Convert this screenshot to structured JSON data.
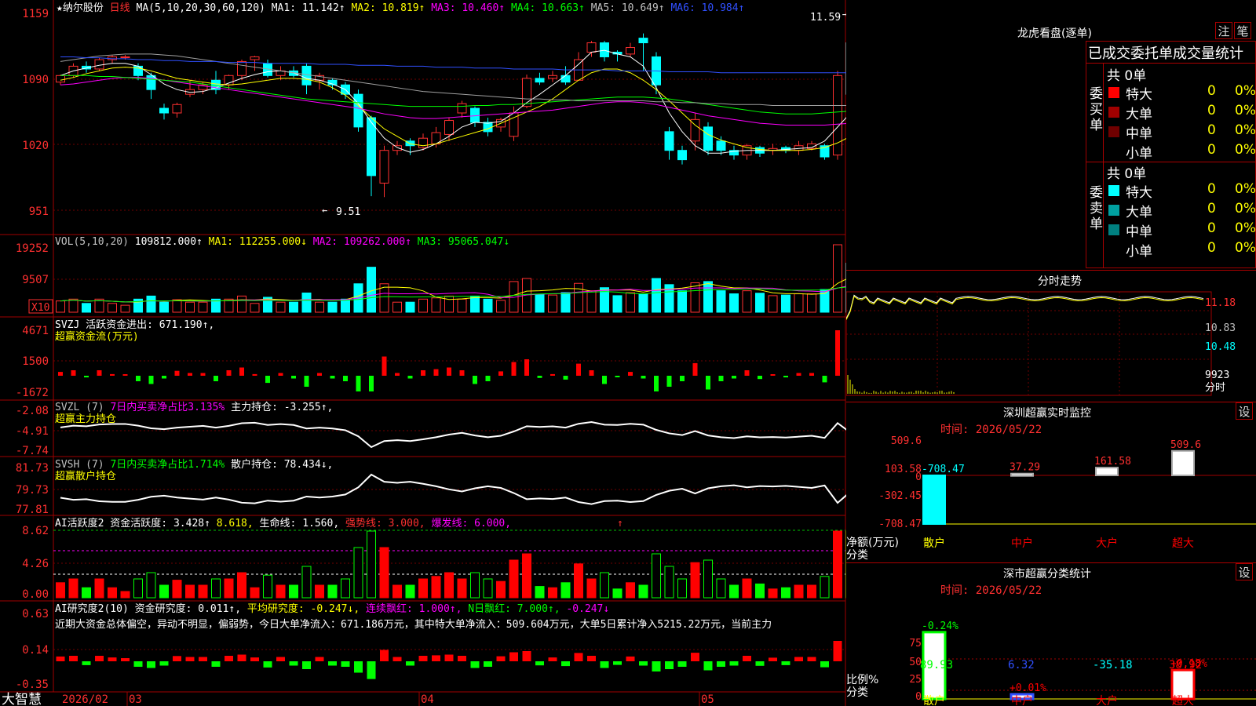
{
  "stock": {
    "name": "纳尔股份",
    "period": "日线",
    "ma_label": "MA(5,10,20,30,60,120)",
    "ma_values": [
      {
        "label": "MA1: 11.142↑",
        "color": "#ffffff"
      },
      {
        "label": "MA2: 10.819↑",
        "color": "#ffff00"
      },
      {
        "label": "MA3: 10.460↑",
        "color": "#ff00ff"
      },
      {
        "label": "MA4: 10.663↑",
        "color": "#00ff00"
      },
      {
        "label": "MA5: 10.649↑",
        "color": "#c0c0c0"
      },
      {
        "label": "MA6: 10.984↑",
        "color": "#3050ff"
      }
    ],
    "price_axis": [
      "1159",
      "1090",
      "1020",
      "951"
    ],
    "high_label": "11.59",
    "low_label": "9.51"
  },
  "vol": {
    "header": "VOL(5,10,20)",
    "value": "109812.000↑",
    "ma1": "MA1: 112255.000↓",
    "ma2": "MA2: 109262.000↑",
    "ma3": "MA3: 95065.047↓",
    "axis": [
      "19252",
      "9507",
      "X10"
    ]
  },
  "svzj": {
    "header": "SVZJ  活跃资金进出: 671.190↑,",
    "sub": "超赢资金流(万元)",
    "axis": [
      "4671",
      "1500",
      "-1672"
    ]
  },
  "svzl": {
    "h1": "SVZL (7)",
    "h2": "7日内买卖净占比3.135%",
    "h3": "主力持仓: -3.255↑,",
    "sub": "超赢主力持仓",
    "axis": [
      "-2.08",
      "-4.91",
      "-7.74"
    ]
  },
  "svsh": {
    "h1": "SVSH (7)",
    "h2": "7日内买卖净占比1.714%",
    "h3": "散户持仓: 78.434↓,",
    "sub": "超赢散户持仓",
    "axis": [
      "81.73",
      "79.73",
      "77.81"
    ]
  },
  "ai_active": {
    "h1": "AI活跃度2 资金活跃度: 3.428↑",
    "h2": "8.618,",
    "h3": "生命线: 1.560,",
    "h4": "强势线: 3.000,",
    "h5": "爆发线: 6.000,",
    "h6": "↑",
    "axis": [
      "8.62",
      "4.26",
      "0.00"
    ]
  },
  "ai_research": {
    "h1": "AI研究度2(10) 资金研究度: 0.011↑,",
    "h2": "平均研究度: -0.247↓,",
    "h3": "连续飘红: 1.000↑,",
    "h4": "N日飘红: 7.000↑,",
    "h5": "-0.247↓",
    "comment": "近期大资金总体偏空，异动不明显，偏弱势，今日大单净流入：671.186万元，其中特大单净流入：509.604万元，大单5日累计净入5215.22万元，当前主力",
    "axis": [
      "0.63",
      "0.14",
      "-0.35"
    ]
  },
  "date_axis": {
    "brand": "大智慧",
    "labels": [
      "2026/02",
      "03",
      "04",
      "05"
    ]
  },
  "right": {
    "lhb_title": "龙虎看盘(逐单)",
    "btn1": "注",
    "btn2": "笔",
    "order_title": "已成交委托单成交量统计",
    "buy_label": "委买单",
    "sell_label": "委卖单",
    "buy_total": "共 0单",
    "sell_total": "共 0单",
    "buy_rows": [
      {
        "name": "特大",
        "count": "0",
        "pct": "0%",
        "color": "#ff0000"
      },
      {
        "name": "大单",
        "count": "0",
        "pct": "0%",
        "color": "#a00000"
      },
      {
        "name": "中单",
        "count": "0",
        "pct": "0%",
        "color": "#700000"
      },
      {
        "name": "小单",
        "count": "0",
        "pct": "0%",
        "color": ""
      }
    ],
    "sell_rows": [
      {
        "name": "特大",
        "count": "0",
        "pct": "0%",
        "color": "#00ffff"
      },
      {
        "name": "大单",
        "count": "0",
        "pct": "0%",
        "color": "#00a0a0"
      },
      {
        "name": "中单",
        "count": "0",
        "pct": "0%",
        "color": "#008080"
      },
      {
        "name": "小单",
        "count": "0",
        "pct": "0%",
        "color": ""
      }
    ],
    "intraday_title": "分时走势",
    "intraday_axis": [
      "11.18",
      "10.83",
      "10.48",
      "9923",
      "分时"
    ],
    "sz_monitor_title": "深圳超赢实时监控",
    "sz_btn": "设",
    "sz_time": "时间: 2026/05/22",
    "sz_axis": [
      "509.6",
      "103.58",
      "0",
      "-302.45",
      "-708.47"
    ],
    "sz_ylabel": "净额(万元)",
    "sz_xlabel": "分类",
    "sz_bars": [
      {
        "cat": "散户",
        "value": -708.47,
        "label": "-708.47",
        "cat_color": "#ffff00"
      },
      {
        "cat": "中户",
        "value": 37.29,
        "label": "37.29",
        "cat_color": "#ff0000"
      },
      {
        "cat": "大户",
        "value": 161.58,
        "label": "161.58",
        "cat_color": "#ff0000"
      },
      {
        "cat": "超大",
        "value": 509.6,
        "label": "509.6",
        "cat_color": "#ff0000"
      }
    ],
    "sc_title": "深市超赢分类统计",
    "sc_btn": "设",
    "sc_time": "时间: 2026/05/22",
    "sc_axis": [
      "75",
      "50",
      "25",
      "0"
    ],
    "sc_ylabel": "比例%",
    "sc_xlabel": "分类",
    "sc_bars": [
      {
        "cat": "散户",
        "value": 89.93,
        "label": "89.93",
        "top": "-0.24%",
        "top_color": "#00ff00",
        "val_color": "#00ff00",
        "cat_color": "#ffff00"
      },
      {
        "cat": "中户",
        "value": 6.32,
        "label": "6.32",
        "top": "+0.01%",
        "top_color": "#ff0000",
        "val_color": "#3050ff",
        "cat_color": "#ff0000"
      },
      {
        "cat": "大户",
        "value": -35.18,
        "label": "-35.18",
        "top": "",
        "top_color": "#ff0000",
        "val_color": "#00ffff",
        "cat_color": "#ff0000"
      },
      {
        "cat": "超大",
        "value": 38.92,
        "label": "38.92",
        "top": "+0.18%",
        "top_color": "#ff0000",
        "val_color": "#ff0000",
        "cat_color": "#ff0000"
      }
    ]
  },
  "chart_data": {
    "type": "candlestick",
    "ylim": [
      9.51,
      11.59
    ],
    "candles": [
      [
        10.88,
        10.95,
        10.85,
        10.96
      ],
      [
        10.95,
        11.05,
        10.93,
        11.08
      ],
      [
        11.05,
        11.02,
        10.98,
        11.1
      ],
      [
        11.02,
        11.12,
        11.0,
        11.14
      ],
      [
        11.12,
        11.15,
        11.08,
        11.17
      ],
      [
        11.15,
        11.15,
        11.12,
        11.17
      ],
      [
        11.05,
        10.95,
        10.9,
        11.08
      ],
      [
        10.95,
        10.8,
        10.7,
        10.98
      ],
      [
        10.6,
        10.55,
        10.48,
        10.65
      ],
      [
        10.55,
        10.64,
        10.5,
        10.66
      ],
      [
        10.75,
        10.8,
        10.72,
        10.9
      ],
      [
        10.8,
        10.85,
        10.75,
        10.88
      ],
      [
        10.9,
        10.8,
        10.75,
        11.0
      ],
      [
        10.85,
        10.95,
        10.8,
        10.96
      ],
      [
        10.95,
        11.1,
        10.9,
        11.12
      ],
      [
        11.12,
        11.15,
        11.0,
        11.16
      ],
      [
        11.08,
        10.95,
        10.93,
        11.12
      ],
      [
        10.95,
        11.0,
        10.9,
        11.05
      ],
      [
        11.0,
        10.95,
        10.93,
        11.05
      ],
      [
        11.05,
        10.85,
        10.75,
        11.08
      ],
      [
        10.9,
        10.95,
        10.8,
        10.98
      ],
      [
        10.9,
        10.85,
        10.8,
        10.92
      ],
      [
        10.85,
        10.75,
        10.7,
        10.88
      ],
      [
        10.75,
        10.4,
        10.35,
        10.8
      ],
      [
        10.5,
        9.88,
        9.66,
        10.52
      ],
      [
        9.8,
        10.15,
        9.65,
        10.2
      ],
      [
        10.15,
        10.2,
        10.1,
        10.25
      ],
      [
        10.25,
        10.2,
        10.1,
        10.28
      ],
      [
        10.18,
        10.28,
        10.15,
        10.33
      ],
      [
        10.22,
        10.34,
        10.18,
        10.4
      ],
      [
        10.32,
        10.47,
        10.25,
        10.5
      ],
      [
        10.55,
        10.65,
        10.5,
        10.68
      ],
      [
        10.6,
        10.45,
        10.4,
        10.62
      ],
      [
        10.45,
        10.35,
        10.3,
        10.5
      ],
      [
        10.4,
        10.48,
        10.35,
        10.5
      ],
      [
        10.3,
        10.55,
        10.25,
        10.62
      ],
      [
        10.62,
        10.92,
        10.6,
        10.96
      ],
      [
        10.92,
        10.88,
        10.85,
        10.98
      ],
      [
        10.92,
        10.95,
        10.88,
        11.0
      ],
      [
        10.95,
        10.88,
        10.85,
        11.05
      ],
      [
        10.9,
        11.12,
        10.9,
        11.2
      ],
      [
        11.2,
        11.3,
        11.15,
        11.32
      ],
      [
        11.3,
        11.15,
        11.1,
        11.32
      ],
      [
        11.2,
        11.18,
        11.1,
        11.22
      ],
      [
        11.18,
        11.25,
        11.15,
        11.3
      ],
      [
        11.35,
        11.3,
        11.0,
        11.4
      ],
      [
        11.15,
        10.85,
        10.75,
        11.2
      ],
      [
        10.35,
        10.15,
        10.05,
        10.4
      ],
      [
        10.15,
        10.05,
        10.0,
        10.2
      ],
      [
        10.25,
        10.48,
        10.15,
        10.55
      ],
      [
        10.4,
        10.15,
        10.1,
        10.45
      ],
      [
        10.25,
        10.15,
        10.1,
        10.3
      ],
      [
        10.15,
        10.1,
        10.05,
        10.2
      ],
      [
        10.1,
        10.2,
        10.05,
        10.22
      ],
      [
        10.18,
        10.12,
        10.08,
        10.2
      ],
      [
        10.15,
        10.17,
        10.1,
        10.22
      ],
      [
        10.18,
        10.15,
        10.12,
        10.2
      ],
      [
        10.15,
        10.2,
        10.1,
        10.25
      ],
      [
        10.17,
        10.22,
        10.15,
        10.25
      ],
      [
        10.2,
        10.08,
        10.05,
        10.22
      ],
      [
        10.1,
        10.95,
        10.05,
        11.0
      ],
      [
        11.3,
        10.75,
        10.7,
        11.35
      ],
      [
        10.75,
        11.0,
        10.7,
        11.05
      ],
      [
        11.05,
        11.2,
        10.98,
        11.25
      ],
      [
        11.1,
        11.35,
        11.05,
        11.5
      ],
      [
        11.35,
        11.15,
        11.1,
        11.38
      ],
      [
        11.2,
        11.18,
        11.1,
        11.2
      ],
      [
        11.2,
        10.92,
        10.88,
        11.25
      ],
      [
        10.95,
        11.5,
        10.9,
        11.59
      ]
    ],
    "ma5": [
      10.95,
      11.0,
      11.03,
      11.06,
      11.08,
      11.08,
      11.05,
      10.96,
      10.86,
      10.8,
      10.77,
      10.78,
      10.82,
      10.87,
      10.92,
      10.96,
      10.99,
      11.0,
      10.98,
      10.92,
      10.9,
      10.86,
      10.8,
      10.65,
      10.45,
      10.28,
      10.18,
      10.13,
      10.16,
      10.22,
      10.3,
      10.4,
      10.45,
      10.44,
      10.46,
      10.55,
      10.66,
      10.75,
      10.85,
      10.95,
      11.07,
      11.2,
      11.22,
      11.18,
      11.15,
      11.05,
      10.82,
      10.55,
      10.35,
      10.2,
      10.12,
      10.12,
      10.14,
      10.15,
      10.15,
      10.15,
      10.16,
      10.17,
      10.18,
      10.25,
      10.4,
      10.55,
      10.7,
      10.88,
      11.0,
      11.1,
      11.12,
      11.13,
      11.14
    ],
    "ma10": [
      10.9,
      10.93,
      10.97,
      11.0,
      11.03,
      11.04,
      11.03,
      11.0,
      10.96,
      10.92,
      10.9,
      10.88,
      10.86,
      10.85,
      10.86,
      10.88,
      10.9,
      10.92,
      10.92,
      10.91,
      10.88,
      10.82,
      10.74,
      10.63,
      10.5,
      10.38,
      10.3,
      10.22,
      10.2,
      10.22,
      10.26,
      10.3,
      10.34,
      10.38,
      10.44,
      10.5,
      10.56,
      10.62,
      10.7,
      10.8,
      10.9,
      10.98,
      11.02,
      11.02,
      10.98,
      10.9,
      10.8,
      10.68,
      10.55,
      10.42,
      10.32,
      10.26,
      10.22,
      10.18,
      10.16,
      10.15,
      10.15,
      10.15,
      10.16,
      10.18,
      10.23,
      10.3,
      10.38,
      10.48,
      10.58,
      10.68,
      10.76,
      10.83,
      10.88
    ],
    "ma20": [
      10.85,
      10.86,
      10.88,
      10.9,
      10.92,
      10.93,
      10.93,
      10.92,
      10.9,
      10.88,
      10.86,
      10.84,
      10.82,
      10.8,
      10.78,
      10.76,
      10.74,
      10.72,
      10.7,
      10.68,
      10.66,
      10.64,
      10.62,
      10.6,
      10.57,
      10.54,
      10.52,
      10.5,
      10.49,
      10.49,
      10.5,
      10.51,
      10.52,
      10.53,
      10.54,
      10.55,
      10.56,
      10.57,
      10.58,
      10.6,
      10.62,
      10.64,
      10.66,
      10.67,
      10.67,
      10.66,
      10.64,
      10.61,
      10.58,
      10.55,
      10.52,
      10.5,
      10.48,
      10.46,
      10.44,
      10.43,
      10.42,
      10.42,
      10.42,
      10.42,
      10.43,
      10.44,
      10.44,
      10.45,
      10.45,
      10.46,
      10.46,
      10.46,
      10.46
    ],
    "ma30": [
      10.95,
      10.95,
      10.95,
      10.94,
      10.94,
      10.93,
      10.92,
      10.91,
      10.9,
      10.89,
      10.88,
      10.86,
      10.84,
      10.82,
      10.8,
      10.78,
      10.76,
      10.74,
      10.72,
      10.7,
      10.69,
      10.68,
      10.67,
      10.66,
      10.65,
      10.64,
      10.63,
      10.62,
      10.62,
      10.62,
      10.62,
      10.62,
      10.63,
      10.63,
      10.64,
      10.64,
      10.65,
      10.66,
      10.67,
      10.68,
      10.69,
      10.7,
      10.71,
      10.72,
      10.72,
      10.72,
      10.71,
      10.7,
      10.68,
      10.66,
      10.64,
      10.62,
      10.6,
      10.58,
      10.56,
      10.55,
      10.54,
      10.54,
      10.54,
      10.55,
      10.56,
      10.57,
      10.58,
      10.6,
      10.62,
      10.63,
      10.64,
      10.65,
      10.66
    ],
    "ma60": [
      11.1,
      11.12,
      11.14,
      11.16,
      11.17,
      11.18,
      11.18,
      11.18,
      11.17,
      11.16,
      11.14,
      11.12,
      11.1,
      11.08,
      11.06,
      11.04,
      11.02,
      11.0,
      10.98,
      10.96,
      10.94,
      10.92,
      10.9,
      10.88,
      10.86,
      10.84,
      10.82,
      10.8,
      10.78,
      10.77,
      10.76,
      10.75,
      10.74,
      10.73,
      10.72,
      10.71,
      10.7,
      10.7,
      10.69,
      10.69,
      10.68,
      10.68,
      10.68,
      10.68,
      10.68,
      10.68,
      10.67,
      10.67,
      10.66,
      10.66,
      10.65,
      10.65,
      10.64,
      10.64,
      10.64,
      10.63,
      10.63,
      10.63,
      10.63,
      10.63,
      10.63,
      10.63,
      10.64,
      10.64,
      10.64,
      10.65,
      10.65,
      10.65,
      10.65
    ],
    "ma120": [
      11.15,
      11.15,
      11.14,
      11.14,
      11.13,
      11.13,
      11.12,
      11.12,
      11.11,
      11.11,
      11.1,
      11.1,
      11.1,
      11.09,
      11.09,
      11.09,
      11.08,
      11.08,
      11.08,
      11.08,
      11.07,
      11.07,
      11.07,
      11.06,
      11.06,
      11.06,
      11.05,
      11.05,
      11.05,
      11.04,
      11.04,
      11.04,
      11.03,
      11.03,
      11.03,
      11.02,
      11.02,
      11.02,
      11.02,
      11.01,
      11.01,
      11.01,
      11.01,
      11.0,
      11.0,
      11.0,
      11.0,
      10.99,
      10.99,
      10.99,
      10.99,
      10.98,
      10.98,
      10.98,
      10.98,
      10.98,
      10.98,
      10.98,
      10.98,
      10.98,
      10.98,
      10.98,
      10.98,
      10.98,
      10.98,
      10.98,
      10.98,
      10.98,
      10.98
    ],
    "volume_series": "derived from candles",
    "fund_flow_series": "derived from candles"
  }
}
